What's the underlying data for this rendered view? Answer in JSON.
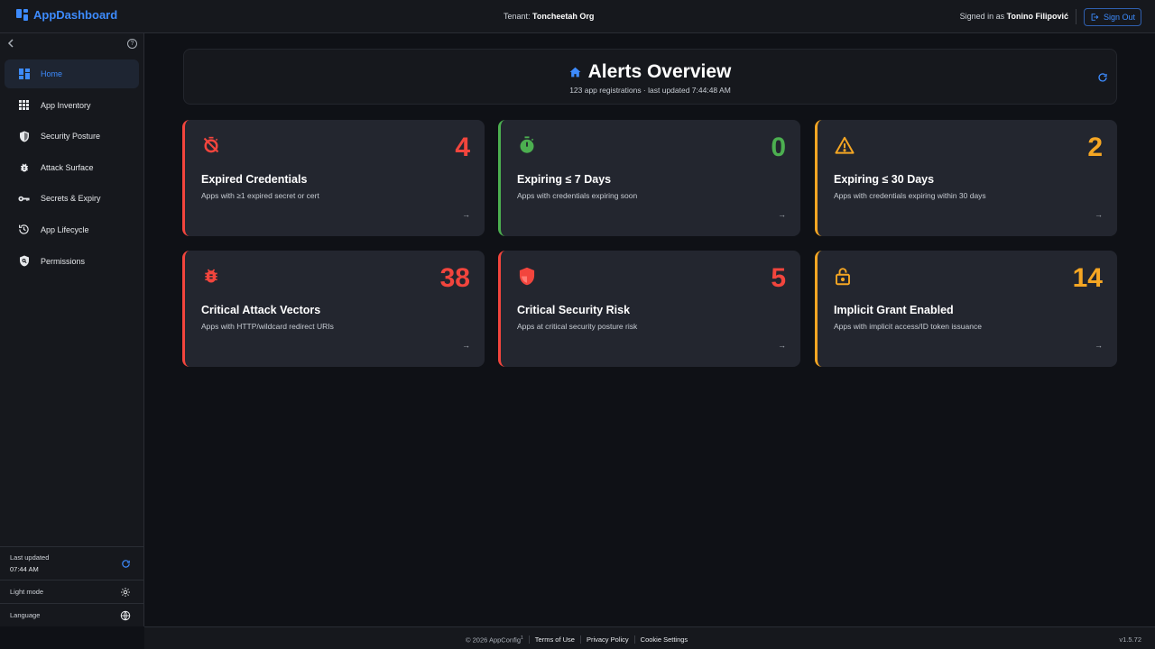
{
  "topbar": {
    "brand": "AppDashboard",
    "tenant_label": "Tenant:",
    "tenant_name": "Toncheetah Org",
    "signed_label": "Signed in as",
    "user_name": "Tonino Filipović",
    "sign_out": "Sign Out"
  },
  "sidebar": {
    "items": [
      {
        "label": "Home",
        "icon": "dashboard-icon"
      },
      {
        "label": "App Inventory",
        "icon": "grid-icon"
      },
      {
        "label": "Security Posture",
        "icon": "shield-icon"
      },
      {
        "label": "Attack Surface",
        "icon": "bug-icon"
      },
      {
        "label": "Secrets & Expiry",
        "icon": "key-icon"
      },
      {
        "label": "App Lifecycle",
        "icon": "history-icon"
      },
      {
        "label": "Permissions",
        "icon": "permission-shield-icon"
      }
    ],
    "last_updated_label": "Last updated",
    "last_updated_time": "07:44 AM",
    "light_mode": "Light mode",
    "language": "Language"
  },
  "header": {
    "title": "Alerts Overview",
    "subtitle": "123 app registrations · last updated 7:44:48 AM"
  },
  "cards": [
    {
      "title": "Expired Credentials",
      "desc": "Apps with ≥1 expired secret or cert",
      "value": "4",
      "color": "#f2453d",
      "icon": "timer-off-icon"
    },
    {
      "title": "Expiring ≤ 7 Days",
      "desc": "Apps with credentials expiring soon",
      "value": "0",
      "color": "#4caf50",
      "icon": "timer-icon"
    },
    {
      "title": "Expiring ≤ 30 Days",
      "desc": "Apps with credentials expiring within 30 days",
      "value": "2",
      "color": "#f5a623",
      "icon": "warning-icon"
    },
    {
      "title": "Critical Attack Vectors",
      "desc": "Apps with HTTP/wildcard redirect URIs",
      "value": "38",
      "color": "#f2453d",
      "icon": "bug-icon"
    },
    {
      "title": "Critical Security Risk",
      "desc": "Apps at critical security posture risk",
      "value": "5",
      "color": "#f2453d",
      "icon": "shield-alert-icon"
    },
    {
      "title": "Implicit Grant Enabled",
      "desc": "Apps with implicit access/ID token issuance",
      "value": "14",
      "color": "#f5a623",
      "icon": "lock-open-icon"
    }
  ],
  "footer": {
    "copyright": "© 2026 AppConfig",
    "copyright_mark": "1",
    "terms": "Terms of Use",
    "privacy": "Privacy Policy",
    "cookies": "Cookie Settings",
    "version": "v1.5.72"
  },
  "colors": {
    "accent": "#3d8bfd",
    "critical": "#f2453d",
    "warning": "#f5a623",
    "ok": "#4caf50"
  }
}
